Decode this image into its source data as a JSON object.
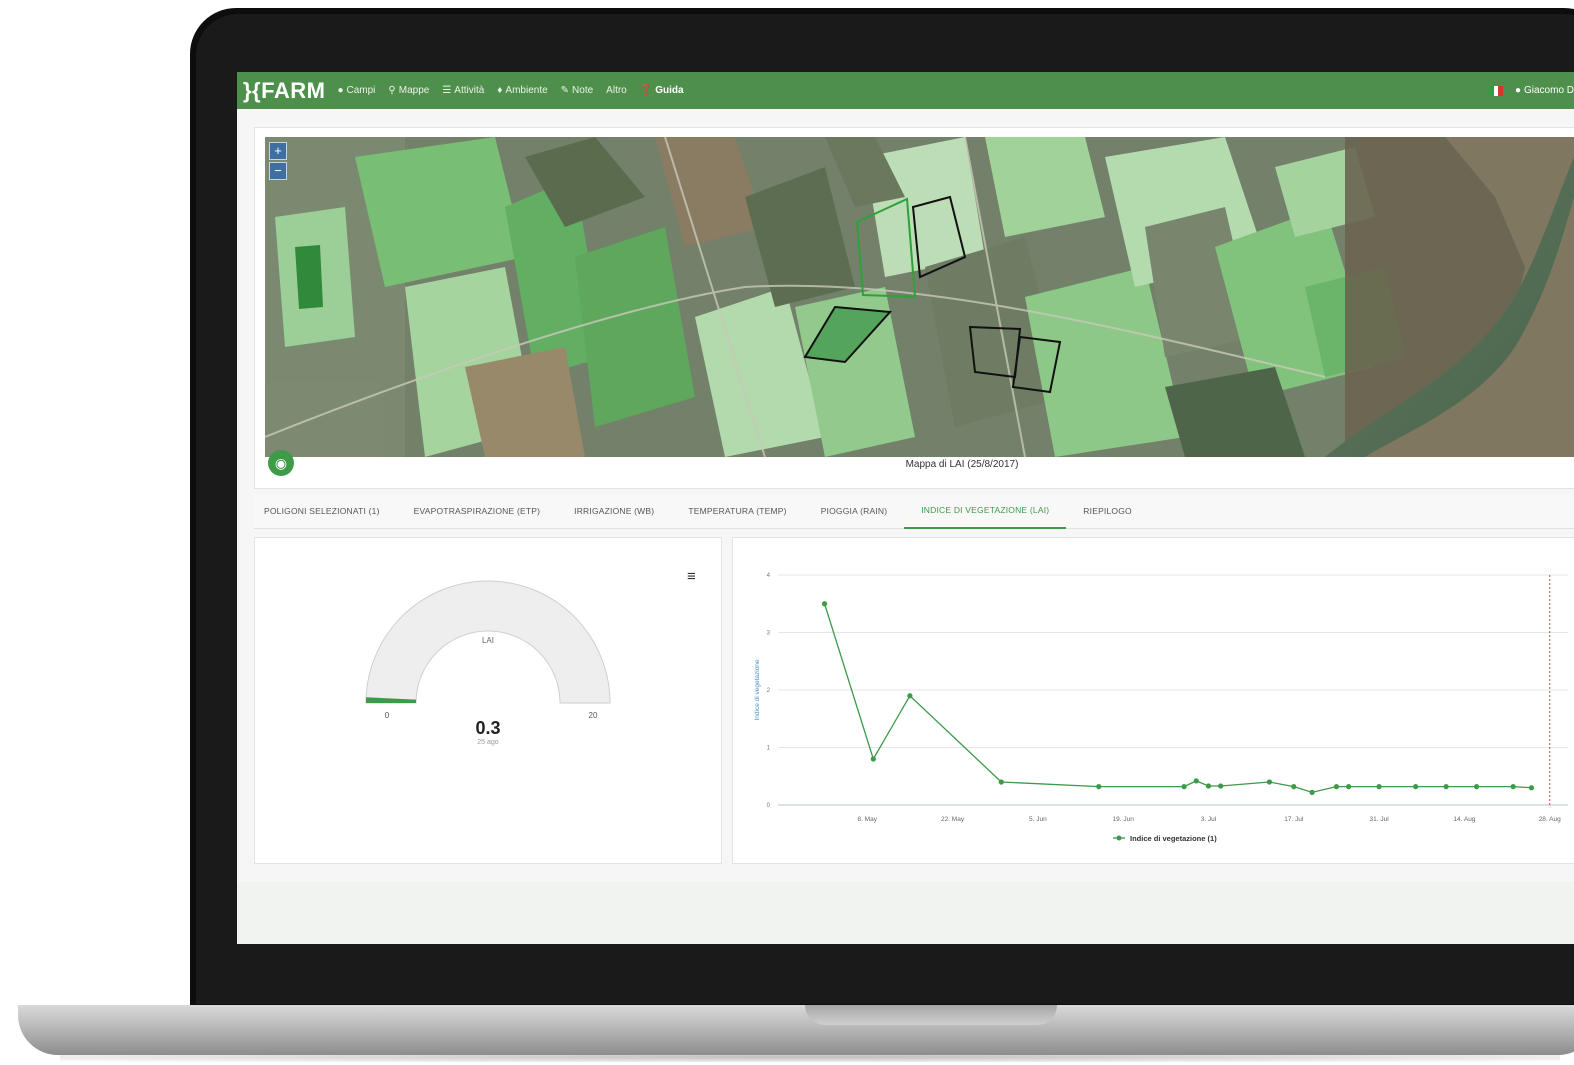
{
  "navbar": {
    "brand": "}{FARM",
    "items": [
      {
        "label": "Campi",
        "icon": "pin-icon"
      },
      {
        "label": "Mappe",
        "icon": "map-marker-icon"
      },
      {
        "label": "Attività",
        "icon": "list-icon"
      },
      {
        "label": "Ambiente",
        "icon": "drop-icon"
      },
      {
        "label": "Note",
        "icon": "edit-icon"
      },
      {
        "label": "Altro",
        "icon": ""
      },
      {
        "label": "Guida",
        "icon": "help-icon"
      }
    ],
    "user": "Giacomo D"
  },
  "map": {
    "caption": "Mappa di LAI (25/8/2017)",
    "zoom_in": "+",
    "zoom_out": "−"
  },
  "tabs": [
    {
      "label": "POLIGONI SELEZIONATI (1)",
      "active": false
    },
    {
      "label": "EVAPOTRASPIRAZIONE (ETP)",
      "active": false
    },
    {
      "label": "IRRIGAZIONE (WB)",
      "active": false
    },
    {
      "label": "TEMPERATURA (TEMP)",
      "active": false
    },
    {
      "label": "PIOGGIA (RAIN)",
      "active": false
    },
    {
      "label": "INDICE DI VEGETAZIONE (LAI)",
      "active": true
    },
    {
      "label": "RIEPILOGO",
      "active": false
    }
  ],
  "gauge": {
    "title": "LAI",
    "value": 0.3,
    "value_label": "0.3",
    "unit": "25 ago",
    "min_label": "0",
    "max_label": "20",
    "min": 0,
    "max": 20,
    "fill_color": "#3c9a48",
    "menu_icon": "hamburger-icon"
  },
  "chart_data": {
    "type": "line",
    "ylabel": "Indice di vegetazione",
    "ylim": [
      0,
      4
    ],
    "yticks": [
      "0",
      "1",
      "2",
      "3",
      "4"
    ],
    "xticks": [
      "8. May",
      "22. May",
      "5. Jun",
      "19. Jun",
      "3. Jul",
      "17. Jul",
      "31. Jul",
      "14. Aug",
      "28. Aug"
    ],
    "series": [
      {
        "name": "Indice di vegetazione (1)",
        "color": "#3c9a48",
        "x": [
          "2017-05-01",
          "2017-05-09",
          "2017-05-15",
          "2017-05-30",
          "2017-06-15",
          "2017-06-29",
          "2017-07-01",
          "2017-07-03",
          "2017-07-05",
          "2017-07-13",
          "2017-07-17",
          "2017-07-20",
          "2017-07-24",
          "2017-07-26",
          "2017-07-31",
          "2017-08-06",
          "2017-08-11",
          "2017-08-16",
          "2017-08-22",
          "2017-08-25"
        ],
        "values": [
          3.5,
          0.8,
          1.9,
          0.4,
          0.32,
          0.32,
          0.42,
          0.33,
          0.33,
          0.4,
          0.32,
          0.22,
          0.32,
          0.32,
          0.32,
          0.32,
          0.32,
          0.32,
          0.32,
          0.3
        ]
      }
    ],
    "marker_date": "2017-08-28",
    "legend": "bottom"
  }
}
